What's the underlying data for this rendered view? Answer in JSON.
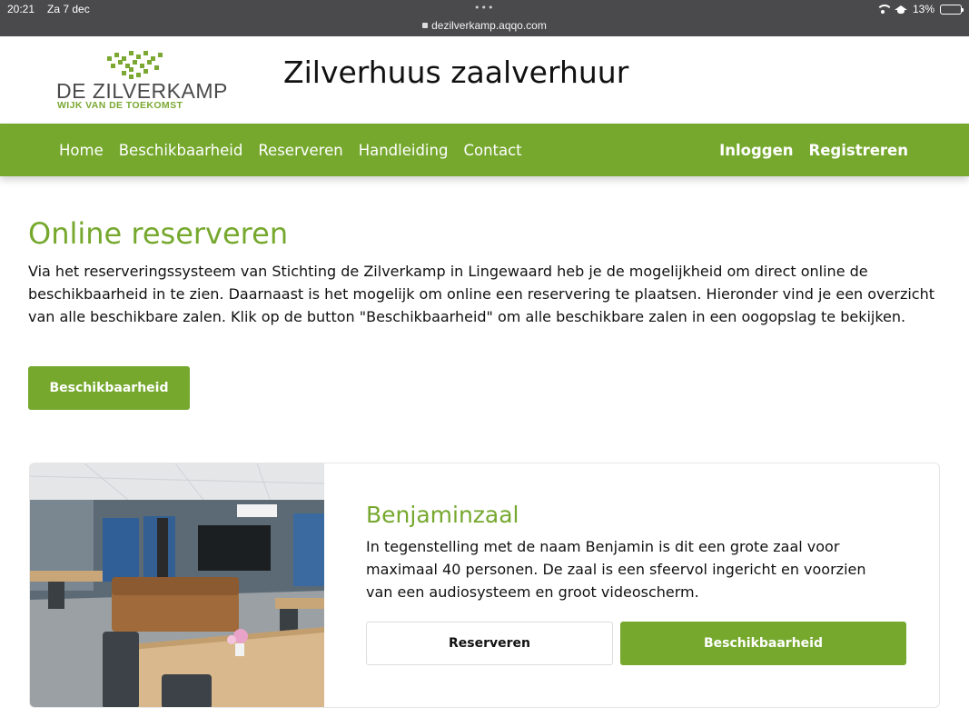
{
  "status_bar": {
    "time": "20:21",
    "date": "Za 7 dec",
    "url": "dezilverkamp.aqqo.com",
    "battery": "13%",
    "battery_level": 0.13
  },
  "header": {
    "logo_title": "DE ZILVERKAMP",
    "logo_subtitle": "WIJK VAN DE TOEKOMST",
    "site_title": "Zilverhuus zaalverhuur"
  },
  "nav": {
    "left": [
      "Home",
      "Beschikbaarheid",
      "Reserveren",
      "Handleiding",
      "Contact"
    ],
    "right": [
      "Inloggen",
      "Registreren"
    ]
  },
  "intro": {
    "heading": "Online reserveren",
    "text": "Via het reserveringssysteem van Stichting de Zilverkamp in Lingewaard heb je de mogelijkheid om direct online de beschikbaarheid in te zien. Daarnaast is het mogelijk om online een reservering te plaatsen. Hieronder vind je een overzicht van alle beschikbare zalen. Klik op de button \"Beschikbaarheid\" om alle beschikbare zalen in een oogopslag te bekijken.",
    "button": "Beschikbaarheid"
  },
  "room": {
    "name": "Benjaminzaal",
    "description": "In tegenstelling met de naam Benjamin is dit een grote zaal voor maximaal 40 personen. De zaal is een sfeervol ingericht en voorzien van een audiosysteem en groot videoscherm.",
    "reserve_button": "Reserveren",
    "availability_button": "Beschikbaarheid"
  },
  "colors": {
    "brand_green": "#76a82e",
    "status_bar": "#4a4a4c"
  }
}
